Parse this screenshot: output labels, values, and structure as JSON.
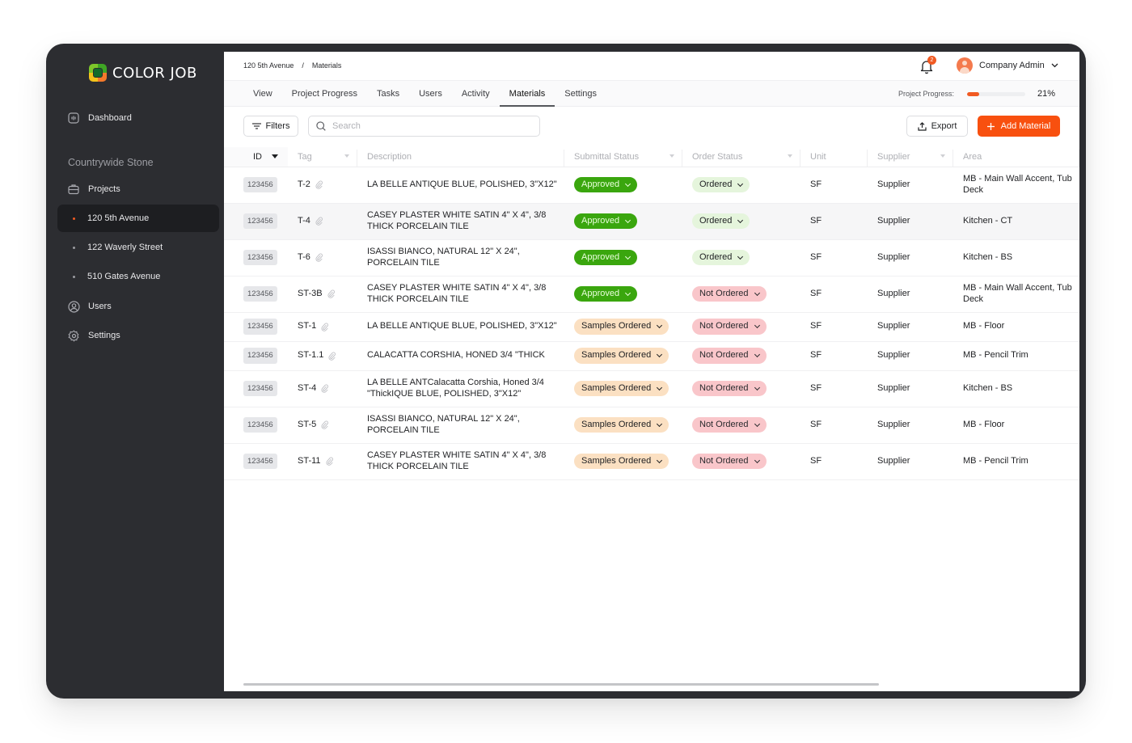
{
  "app": {
    "brand": "COLOR JOB",
    "org_name": "Countrywide Stone"
  },
  "sidebar": {
    "items": [
      {
        "label": "Dashboard",
        "icon": "dashboard-icon"
      },
      {
        "label": "Projects",
        "icon": "briefcase-icon"
      },
      {
        "label": "120 5th Avenue",
        "icon": "dot",
        "active": true
      },
      {
        "label": "122 Waverly Street",
        "icon": "dot"
      },
      {
        "label": "510 Gates Avenue",
        "icon": "dot"
      },
      {
        "label": "Users",
        "icon": "user-circle-icon"
      },
      {
        "label": "Settings",
        "icon": "gear-icon"
      }
    ]
  },
  "header": {
    "breadcrumb": [
      "120 5th Avenue",
      "/",
      "Materials"
    ],
    "notifications_count": "2",
    "user_name": "Company Admin"
  },
  "tabs": [
    {
      "label": "View"
    },
    {
      "label": "Project Progress"
    },
    {
      "label": "Tasks"
    },
    {
      "label": "Users"
    },
    {
      "label": "Activity"
    },
    {
      "label": "Materials",
      "active": true
    },
    {
      "label": "Settings"
    }
  ],
  "progress": {
    "label": "Project Progress:",
    "percent": 21,
    "percent_text": "21%"
  },
  "toolbar": {
    "filters_label": "Filters",
    "search_placeholder": "Search",
    "search_value": "",
    "export_label": "Export",
    "add_label": "Add Material"
  },
  "colors": {
    "accent": "#f8500f",
    "approved": "#3aa60e",
    "ordered": "#e5f5dc",
    "samples_ordered": "#fbe0c2",
    "not_ordered": "#f9c6ca"
  },
  "table": {
    "columns": [
      "ID",
      "Tag",
      "Description",
      "Submittal Status",
      "Order Status",
      "Unit",
      "Supplier",
      "Area"
    ],
    "rows": [
      {
        "id": "123456",
        "tag": "T-2",
        "description": "LA BELLE ANTIQUE BLUE, POLISHED, 3\"X12\"",
        "submittal": "Approved",
        "order": "Ordered",
        "unit": "SF",
        "supplier": "Supplier",
        "area": "MB - Main Wall Accent, Tub Deck"
      },
      {
        "id": "123456",
        "tag": "T-4",
        "description": "CASEY PLASTER WHITE SATIN 4\" X 4\", 3/8 THICK PORCELAIN TILE",
        "submittal": "Approved",
        "order": "Ordered",
        "unit": "SF",
        "supplier": "Supplier",
        "area": "Kitchen - CT"
      },
      {
        "id": "123456",
        "tag": "T-6",
        "description": "ISASSI BIANCO, NATURAL 12\" X 24\", PORCELAIN TILE",
        "submittal": "Approved",
        "order": "Ordered",
        "unit": "SF",
        "supplier": "Supplier",
        "area": "Kitchen - BS"
      },
      {
        "id": "123456",
        "tag": "ST-3B",
        "description": "CASEY PLASTER WHITE SATIN 4\" X 4\", 3/8 THICK PORCELAIN TILE",
        "submittal": "Approved",
        "order": "Not Ordered",
        "unit": "SF",
        "supplier": "Supplier",
        "area": "MB - Main Wall Accent, Tub Deck"
      },
      {
        "id": "123456",
        "tag": "ST-1",
        "description": "LA BELLE ANTIQUE BLUE, POLISHED, 3\"X12\"",
        "submittal": "Samples Ordered",
        "order": "Not Ordered",
        "unit": "SF",
        "supplier": "Supplier",
        "area": "MB - Floor"
      },
      {
        "id": "123456",
        "tag": "ST-1.1",
        "description": "CALACATTA CORSHIA, HONED 3/4 \"THICK",
        "submittal": "Samples Ordered",
        "order": "Not Ordered",
        "unit": "SF",
        "supplier": "Supplier",
        "area": "MB - Pencil Trim"
      },
      {
        "id": "123456",
        "tag": "ST-4",
        "description": "LA BELLE ANTCalacatta Corshia, Honed 3/4 \"ThickIQUE BLUE, POLISHED, 3\"X12\"",
        "submittal": "Samples Ordered",
        "order": "Not Ordered",
        "unit": "SF",
        "supplier": "Supplier",
        "area": "Kitchen - BS"
      },
      {
        "id": "123456",
        "tag": "ST-5",
        "description": "ISASSI BIANCO, NATURAL 12\" X 24\", PORCELAIN TILE",
        "submittal": "Samples Ordered",
        "order": "Not Ordered",
        "unit": "SF",
        "supplier": "Supplier",
        "area": "MB - Floor"
      },
      {
        "id": "123456",
        "tag": "ST-11",
        "description": "CASEY PLASTER WHITE SATIN 4\" X 4\", 3/8 THICK PORCELAIN TILE",
        "submittal": "Samples Ordered",
        "order": "Not Ordered",
        "unit": "SF",
        "supplier": "Supplier",
        "area": "MB - Pencil Trim"
      }
    ]
  }
}
